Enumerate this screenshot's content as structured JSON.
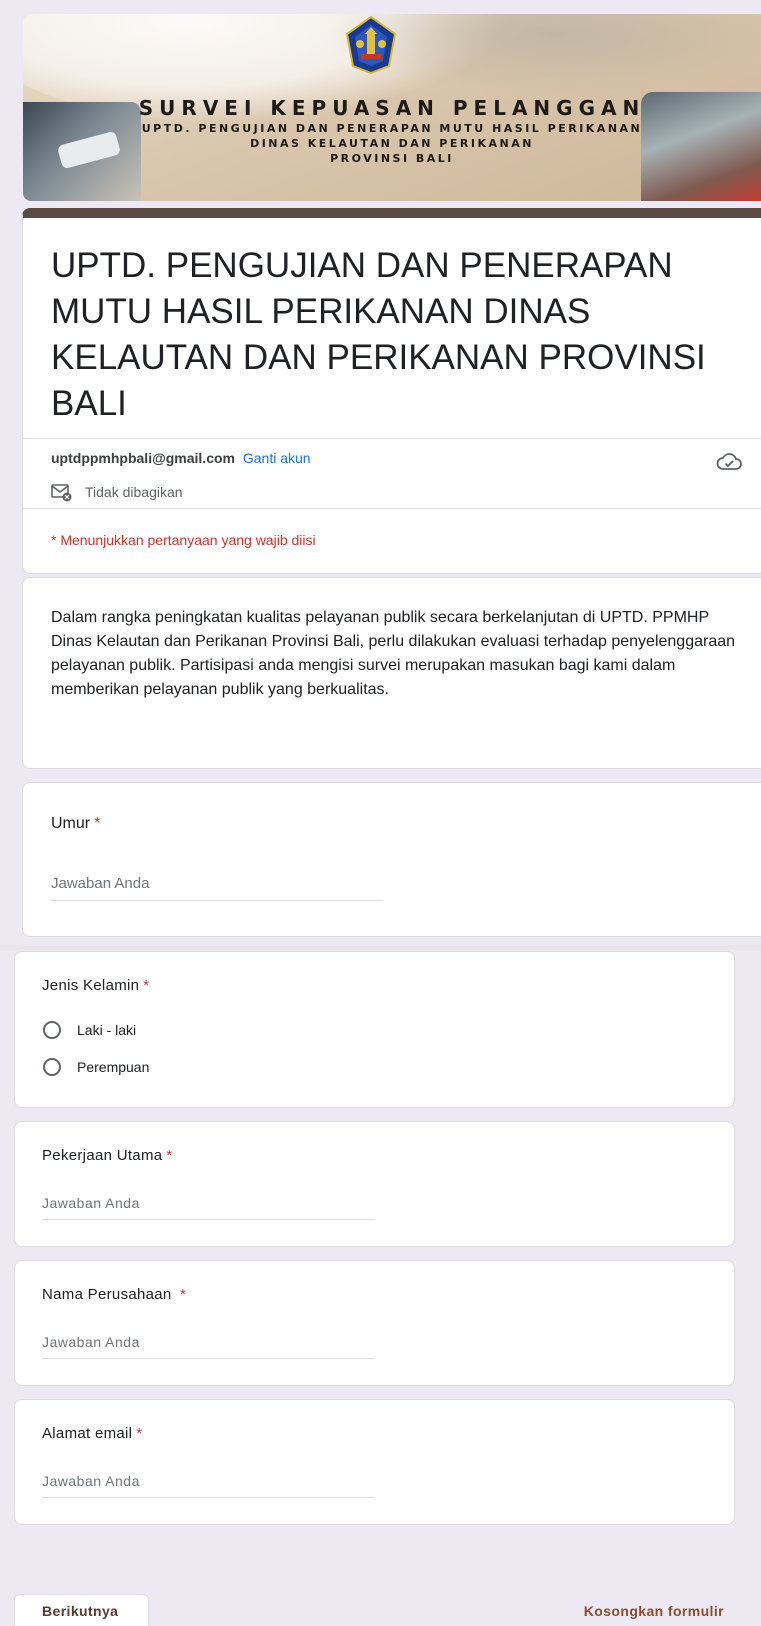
{
  "banner": {
    "title": "SURVEI KEPUASAN PELANGGAN",
    "subtitle_lines": [
      "UPTD. PENGUJIAN DAN PENERAPAN MUTU HASIL PERIKANAN",
      "DINAS KELAUTAN DAN PERIKANAN",
      "PROVINSI BALI"
    ],
    "logo_icon": "provincial-emblem-icon"
  },
  "form": {
    "title": "UPTD. PENGUJIAN DAN PENERAPAN MUTU HASIL PERIKANAN DINAS KELAUTAN DAN PERIKANAN PROVINSI BALI",
    "account_email": "uptdppmhpbali@gmail.com",
    "switch_account": "Ganti akun",
    "not_shared": "Tidak dibagikan",
    "required_note": "* Menunjukkan pertanyaan yang wajib diisi",
    "description": "Dalam rangka peningkatan kualitas pelayanan publik secara berkelanjutan di UPTD. PPMHP Dinas Kelautan dan Perikanan Provinsi Bali, perlu dilakukan evaluasi terhadap penyelenggaraan pelayanan publik. Partisipasi anda mengisi survei merupakan masukan bagi kami dalam memberikan pelayanan publik yang berkualitas."
  },
  "questions": {
    "age": {
      "label": "Umur",
      "required_mark": "*",
      "placeholder": "Jawaban Anda"
    },
    "gender": {
      "label": "Jenis Kelamin",
      "required_mark": "*",
      "options": [
        "Laki - laki",
        "Perempuan"
      ]
    },
    "occupation": {
      "label": "Pekerjaan Utama",
      "required_mark": "*",
      "placeholder": "Jawaban Anda"
    },
    "company": {
      "label": "Nama Perusahaan ",
      "required_mark": "*",
      "placeholder": "Jawaban Anda"
    },
    "email": {
      "label": "Alamat email",
      "required_mark": "*",
      "placeholder": "Jawaban Anda"
    }
  },
  "footer": {
    "next_button": "Berikutnya",
    "clear_form": "Kosongkan formulir"
  },
  "colors": {
    "accent": "#5b4a43",
    "required": "#d93025",
    "link": "#1a73e8",
    "button_text": "#5b3a2e"
  }
}
